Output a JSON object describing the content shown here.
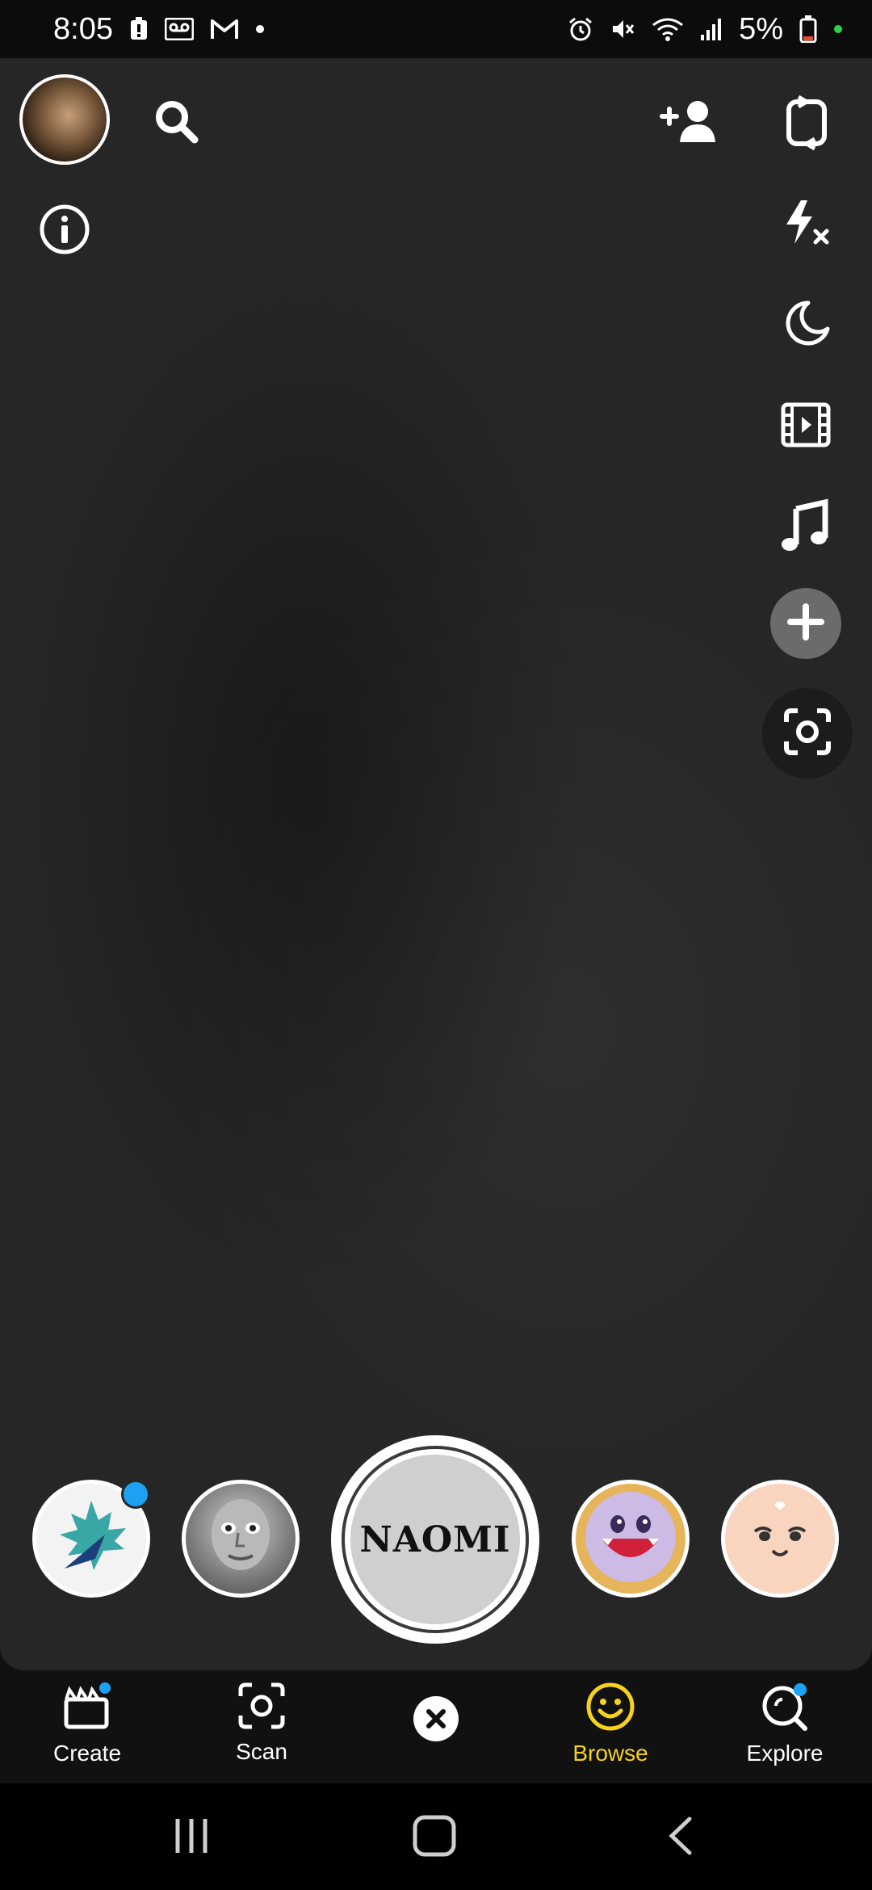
{
  "status_bar": {
    "time": "8:05",
    "battery_percent": "5%",
    "left_icons": [
      "battery-alert-icon",
      "voicemail-icon",
      "gmail-icon",
      "dot-icon"
    ],
    "right_icons": [
      "alarm-icon",
      "mute-icon",
      "wifi-icon",
      "signal-icon",
      "battery-icon"
    ]
  },
  "camera": {
    "top_left": [
      "profile-avatar",
      "search-icon",
      "info-icon"
    ],
    "top_right": [
      "add-friend-icon",
      "flip-camera-icon"
    ],
    "side_tools": [
      "flash-off-icon",
      "night-mode-icon",
      "video-timer-icon",
      "music-icon",
      "plus-icon",
      "scan-icon"
    ]
  },
  "lens_carousel": {
    "capture_label": "NAOMI",
    "lenses": [
      "maple-leaf-lens",
      "grey-face-lens",
      "naomi-lens",
      "vampire-smile-lens",
      "cute-face-lens"
    ]
  },
  "bottom_nav": {
    "items": [
      {
        "label": "Create",
        "icon": "create-clapper-icon",
        "badge": true
      },
      {
        "label": "Scan",
        "icon": "scan-icon"
      },
      {
        "label": "",
        "icon": "close-icon"
      },
      {
        "label": "Browse",
        "icon": "smiley-icon",
        "active": true
      },
      {
        "label": "Explore",
        "icon": "explore-icon",
        "badge": true
      }
    ],
    "active_color": "#f7d21a"
  },
  "system_nav": [
    "recents-icon",
    "home-icon",
    "back-icon"
  ]
}
